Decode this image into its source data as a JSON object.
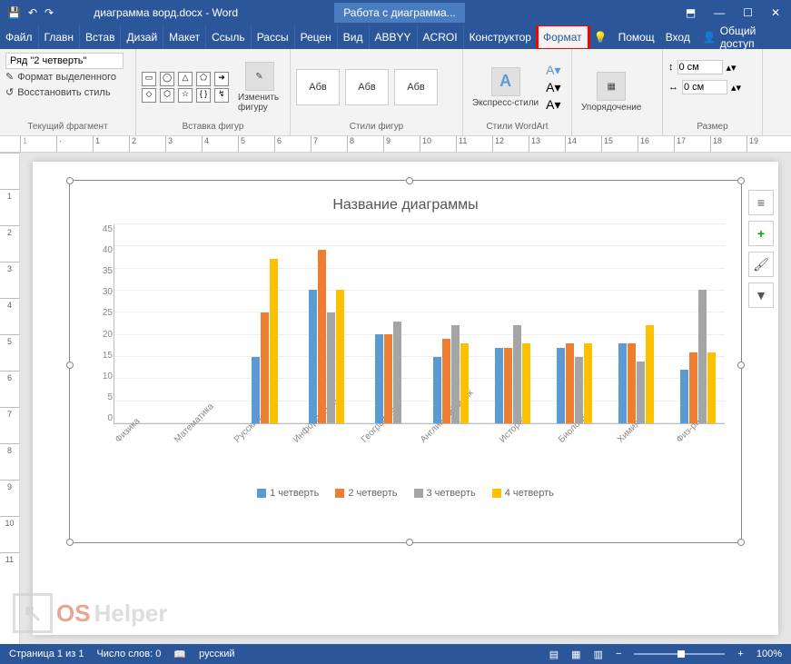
{
  "title_bar": {
    "doc_title": "диаграмма ворд.docx - Word",
    "chart_tools": "Работа с диаграмма..."
  },
  "menu": {
    "tabs": [
      "Файл",
      "Главн",
      "Встав",
      "Дизай",
      "Макет",
      "Ссыль",
      "Рассы",
      "Рецен",
      "Вид",
      "ABBYY",
      "ACROI",
      "Конструктор",
      "Формат"
    ],
    "help": "Помощ",
    "login": "Вход",
    "share": "Общий доступ"
  },
  "ribbon": {
    "g1_label": "Текущий фрагмент",
    "g1_dropdown": "Ряд \"2 четверть\"",
    "g1_item1": "Формат выделенного",
    "g1_item2": "Восстановить стиль",
    "g2_label": "Вставка фигур",
    "g2_edit": "Изменить фигуру",
    "g3_label": "Стили фигур",
    "g3_abc": "Абв",
    "g4_label": "Стили WordArt",
    "g4_express": "Экспресс-стили",
    "g5_label": "Упорядочение",
    "g5_arrange": "Упорядочение",
    "g6_label": "Размер",
    "g6_h": "0 см",
    "g6_w": "0 см"
  },
  "chart_data": {
    "type": "bar",
    "title": "Название диаграммы",
    "ylim": [
      0,
      45
    ],
    "yticks": [
      0,
      5,
      10,
      15,
      20,
      25,
      30,
      35,
      40,
      45
    ],
    "categories": [
      "Физика",
      "Математика",
      "Русский",
      "Информатика",
      "География",
      "Английский язык",
      "История",
      "Биология",
      "Химия",
      "Физ-ра"
    ],
    "series": [
      {
        "name": "1 четверть",
        "color": "#5b9bd5",
        "values": [
          null,
          null,
          15,
          30,
          20,
          15,
          17,
          17,
          18,
          12
        ]
      },
      {
        "name": "2 четверть",
        "color": "#ed7d31",
        "values": [
          null,
          null,
          25,
          39,
          20,
          19,
          17,
          18,
          18,
          16
        ]
      },
      {
        "name": "3 четверть",
        "color": "#a5a5a5",
        "values": [
          null,
          null,
          null,
          25,
          23,
          22,
          22,
          15,
          14,
          30
        ]
      },
      {
        "name": "4 четверть",
        "color": "#ffc000",
        "values": [
          null,
          null,
          37,
          30,
          null,
          18,
          18,
          18,
          22,
          16
        ]
      }
    ]
  },
  "status": {
    "page": "Страница 1 из 1",
    "words": "Число слов: 0",
    "lang": "русский",
    "zoom": "100%"
  },
  "watermark": {
    "brand1": "OS",
    "brand2": "Helper"
  }
}
